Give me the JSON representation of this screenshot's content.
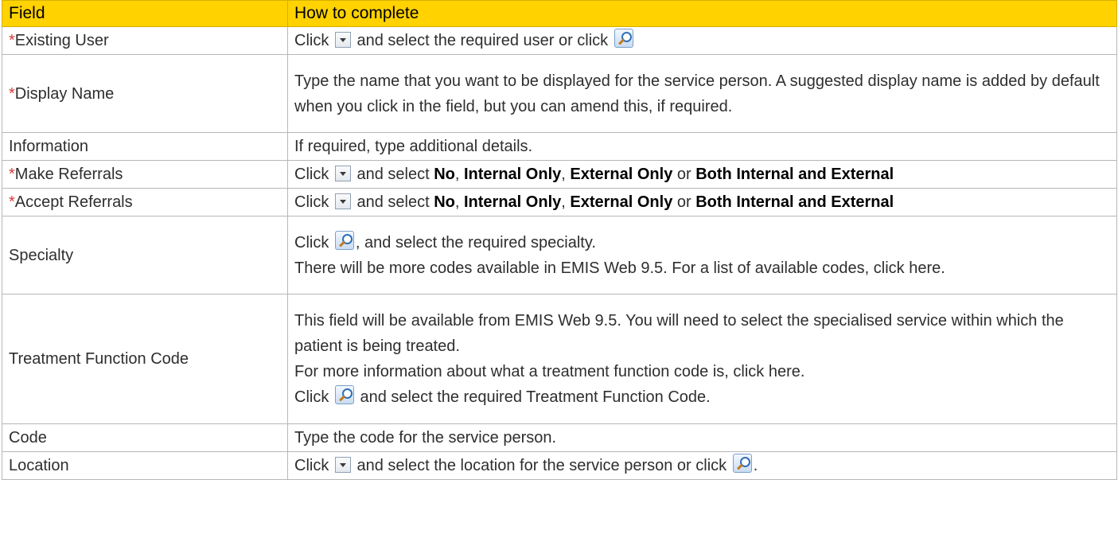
{
  "header": {
    "field": "Field",
    "how": "How to complete"
  },
  "rows": {
    "r0": {
      "required_mark": "*",
      "field": "Existing User",
      "p1a": "Click",
      "p1b": "and select the required user or click"
    },
    "r1": {
      "required_mark": "*",
      "field": "Display Name",
      "text": "Type the name that you want to be displayed for the service person. A suggested display name is added by default when you click in the field, but you can amend this, if required."
    },
    "r2": {
      "field": "Information",
      "text": "If required, type additional details."
    },
    "r3": {
      "required_mark": "*",
      "field": "Make Referrals",
      "p1a": "Click",
      "p1b": "and select",
      "opt1": "No",
      "comma": ",",
      "opt2": "Internal Only",
      "comma2": ",",
      "opt3": "External Only",
      "or": "or",
      "opt4": "Both Internal and External"
    },
    "r4": {
      "required_mark": "*",
      "field": "Accept Referrals",
      "p1a": "Click",
      "p1b": "and select",
      "opt1": "No",
      "comma": ",",
      "opt2": "Internal Only",
      "comma2": ",",
      "opt3": "External Only",
      "or": "or",
      "opt4": "Both Internal and External"
    },
    "r5": {
      "field": "Specialty",
      "p1a": "Click",
      "p1b": ", and select the required specialty.",
      "p2": "There will be more codes available in EMIS Web 9.5. For a list of available codes, click here."
    },
    "r6": {
      "field": "Treatment Function Code",
      "p1": "This field will be available from EMIS Web 9.5. You will need to select the specialised service within which the patient is being treated.",
      "p2": "For more information about what a treatment function code is, click here.",
      "p3a": "Click",
      "p3b": "and select the required Treatment Function Code."
    },
    "r7": {
      "field": "Code",
      "text": "Type the code for the service person."
    },
    "r8": {
      "field": "Location",
      "p1a": "Click",
      "p1b": "and select the location for the service person or click",
      "p1c": "."
    }
  },
  "icons": {
    "dropdown": "dropdown-arrow-icon",
    "search": "search-magnifier-icon"
  },
  "colors": {
    "header_bg": "#ffd200",
    "required_mark": "#d83a3a",
    "border": "#b7b7b7"
  }
}
